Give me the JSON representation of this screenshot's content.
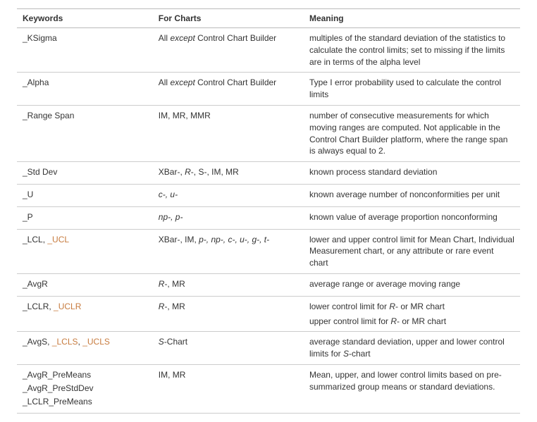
{
  "headers": {
    "keywords": "Keywords",
    "charts": "For Charts",
    "meaning": "Meaning"
  },
  "rows": [
    {
      "keywords": [
        [
          {
            "text": "_KSigma",
            "link": false
          }
        ]
      ],
      "charts": [
        {
          "text": "All ",
          "italic": false
        },
        {
          "text": "except",
          "italic": true
        },
        {
          "text": " Control Chart Builder",
          "italic": false
        }
      ],
      "meaning": [
        "multiples of the standard deviation of the statistics to calculate the control limits; set to missing if the limits are in terms of the alpha level"
      ]
    },
    {
      "keywords": [
        [
          {
            "text": "_Alpha",
            "link": false
          }
        ]
      ],
      "charts": [
        {
          "text": "All ",
          "italic": false
        },
        {
          "text": "except",
          "italic": true
        },
        {
          "text": " Control Chart Builder",
          "italic": false
        }
      ],
      "meaning": [
        "Type I error probability used to calculate the control limits"
      ]
    },
    {
      "keywords": [
        [
          {
            "text": "_Range Span",
            "link": false
          }
        ]
      ],
      "charts": [
        {
          "text": "IM, MR, MMR",
          "italic": false
        }
      ],
      "meaning": [
        "number of consecutive measurements for which moving ranges are computed. Not applicable in the Control Chart Builder platform, where the range span is always equal to 2."
      ]
    },
    {
      "keywords": [
        [
          {
            "text": "_Std Dev",
            "link": false
          }
        ]
      ],
      "charts": [
        {
          "text": "XBar-, ",
          "italic": false
        },
        {
          "text": "R",
          "italic": true
        },
        {
          "text": "-, S-, IM, MR",
          "italic": false
        }
      ],
      "meaning": [
        "known process standard deviation"
      ]
    },
    {
      "keywords": [
        [
          {
            "text": "_U",
            "link": false
          }
        ]
      ],
      "charts": [
        {
          "text": "c-, u-",
          "italic": true
        }
      ],
      "meaning": [
        "known average number of nonconformities per unit"
      ]
    },
    {
      "keywords": [
        [
          {
            "text": "_P",
            "link": false
          }
        ]
      ],
      "charts": [
        {
          "text": "np-, p-",
          "italic": true
        }
      ],
      "meaning": [
        "known value of average proportion nonconforming"
      ]
    },
    {
      "keywords": [
        [
          {
            "text": "_LCL, ",
            "link": false
          },
          {
            "text": "_UCL",
            "link": true
          }
        ]
      ],
      "charts": [
        {
          "text": "XBar-, IM, ",
          "italic": false
        },
        {
          "text": "p-, np-, c-, u-, g-, t-",
          "italic": true
        }
      ],
      "meaning": [
        "lower and upper control limit for Mean Chart, Individual Measurement chart, or any attribute or rare event chart"
      ]
    },
    {
      "keywords": [
        [
          {
            "text": "_AvgR",
            "link": false
          }
        ]
      ],
      "charts": [
        {
          "text": "R",
          "italic": true
        },
        {
          "text": "-, MR",
          "italic": false
        }
      ],
      "meaning": [
        "average range or average moving range"
      ]
    },
    {
      "keywords": [
        [
          {
            "text": "_LCLR, ",
            "link": false
          },
          {
            "text": "_UCLR",
            "link": true
          }
        ]
      ],
      "charts": [
        {
          "text": "R",
          "italic": true
        },
        {
          "text": "-, MR",
          "italic": false
        }
      ],
      "meaning_rich": [
        [
          {
            "text": "lower control limit for ",
            "italic": false
          },
          {
            "text": "R",
            "italic": true
          },
          {
            "text": "- or MR chart",
            "italic": false
          }
        ],
        [
          {
            "text": "upper control limit for ",
            "italic": false
          },
          {
            "text": "R",
            "italic": true
          },
          {
            "text": "- or MR chart",
            "italic": false
          }
        ]
      ]
    },
    {
      "keywords": [
        [
          {
            "text": "_AvgS, ",
            "link": false
          },
          {
            "text": "_LCLS",
            "link": true
          },
          {
            "text": ", ",
            "link": false
          },
          {
            "text": "_UCLS",
            "link": true
          }
        ]
      ],
      "charts": [
        {
          "text": "S",
          "italic": true
        },
        {
          "text": "-Chart",
          "italic": false
        }
      ],
      "meaning_rich": [
        [
          {
            "text": "average standard deviation, upper and lower control limits for ",
            "italic": false
          },
          {
            "text": "S",
            "italic": true
          },
          {
            "text": "-chart",
            "italic": false
          }
        ]
      ]
    },
    {
      "keywords": [
        [
          {
            "text": "_AvgR_PreMeans",
            "link": false
          }
        ],
        [
          {
            "text": "_AvgR_PreStdDev",
            "link": false
          }
        ],
        [
          {
            "text": "_LCLR_PreMeans",
            "link": false
          }
        ]
      ],
      "charts": [
        {
          "text": "IM, MR",
          "italic": false
        }
      ],
      "meaning": [
        "Mean, upper, and lower control limits based on pre-summarized group means or standard deviations."
      ]
    }
  ]
}
